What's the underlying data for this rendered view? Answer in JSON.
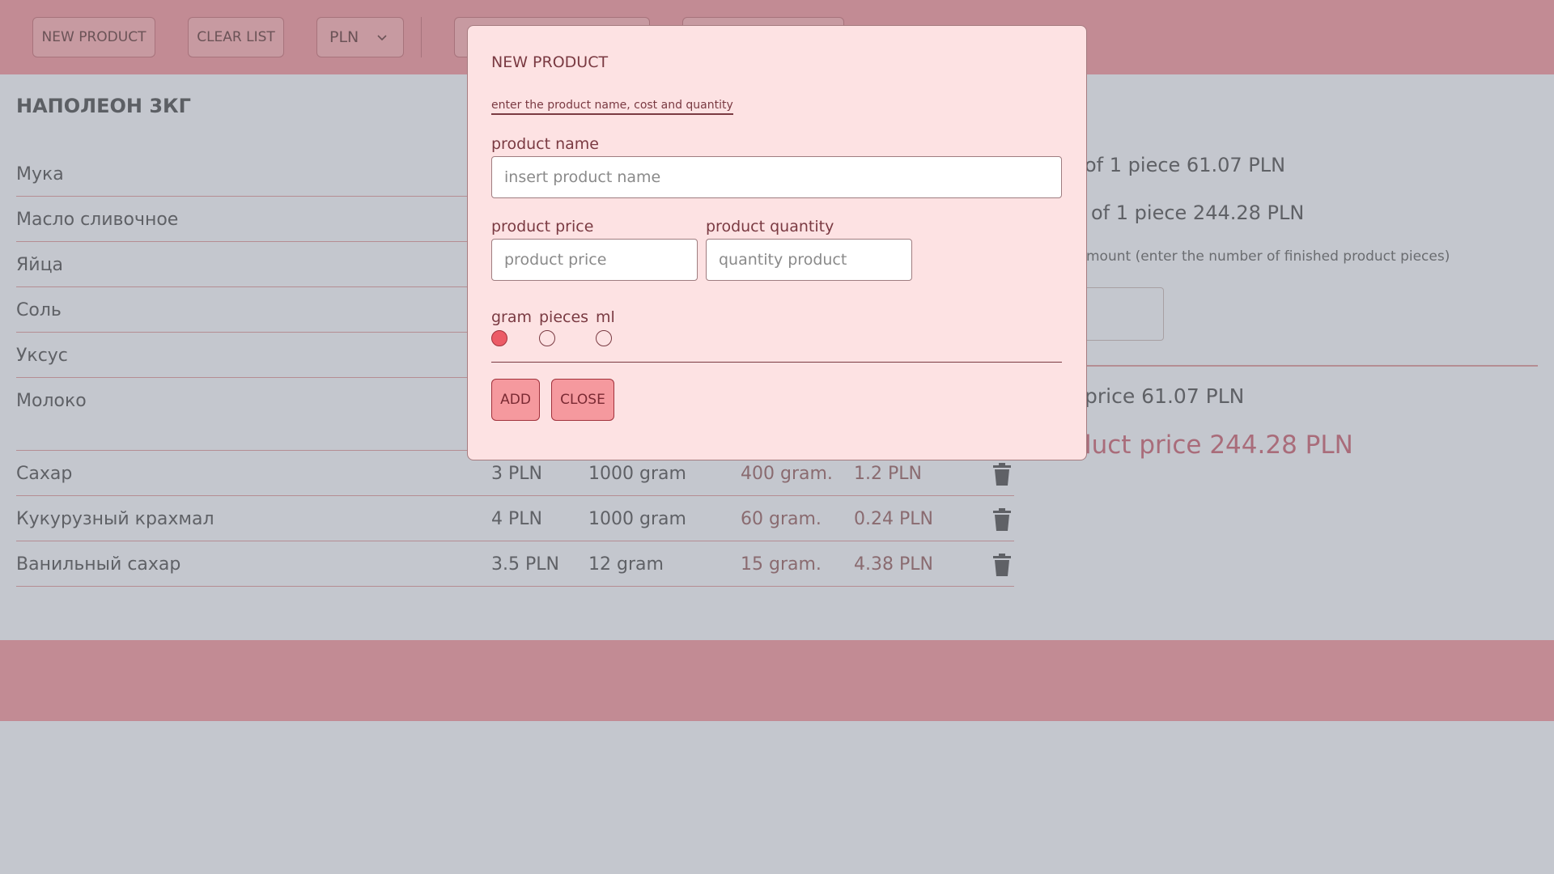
{
  "toolbar": {
    "new_product_label": "NEW PRODUCT",
    "clear_list_label": "CLEAR LIST",
    "currency_value": "PLN"
  },
  "recipe": {
    "title": "НАПОЛЕОН 3КГ",
    "ingredients_top": [
      "Мука",
      "Масло сливочное",
      "Яйца",
      "Соль",
      "Уксус",
      "Молоко"
    ],
    "rows": [
      {
        "name": "Сахар",
        "price": "3 PLN",
        "package": "1000 gram",
        "used": "400 gram.",
        "cost": "1.2 PLN"
      },
      {
        "name": "Кукурузный крахмал",
        "price": "4 PLN",
        "package": "1000 gram",
        "used": "60 gram.",
        "cost": "0.24 PLN"
      },
      {
        "name": "Ванильный сахар",
        "price": "3.5 PLN",
        "package": "12 gram",
        "used": "15 gram.",
        "cost": "4.38 PLN"
      }
    ]
  },
  "summary": {
    "line1": "of 1 piece 61.07 PLN",
    "line2": "of 1 piece 244.28 PLN",
    "line3": "mount (enter the number of finished product pieces)",
    "line4": "price 61.07 PLN",
    "line5": "luct price 244.28 PLN"
  },
  "modal": {
    "title": "NEW PRODUCT",
    "subtitle": "enter the product name, cost and quantity",
    "name_label": "product name",
    "name_placeholder": "insert product name",
    "price_label": "product price",
    "price_placeholder": "product price",
    "quantity_label": "product quantity",
    "quantity_placeholder": "quantity product",
    "units": [
      "gram",
      "pieces",
      "ml"
    ],
    "selected_unit": "gram",
    "add_label": "ADD",
    "close_label": "CLOSE"
  },
  "colors": {
    "topbar": "#c28b94",
    "modal_bg": "#fde2e3",
    "accent": "#ec5b66"
  }
}
